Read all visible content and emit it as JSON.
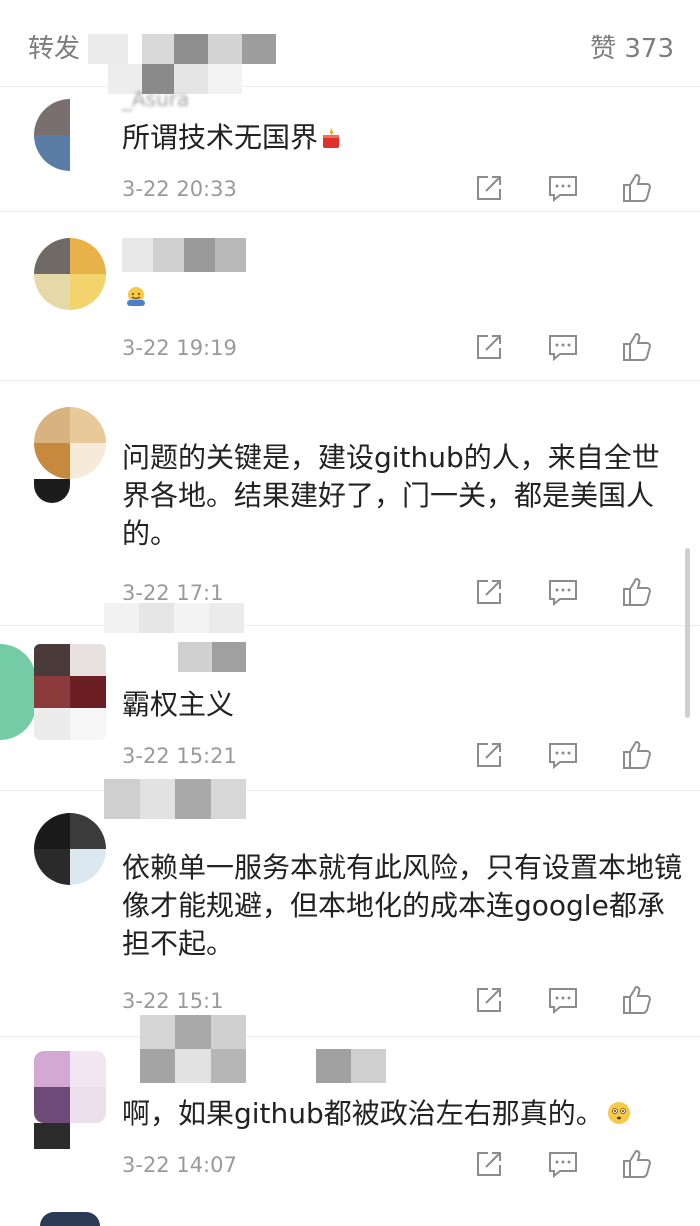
{
  "header": {
    "repost_label": "转发",
    "likes_label": "赞 373"
  },
  "comments": [
    {
      "username": "_Asura",
      "text": "所谓技术无国界",
      "time": "3-22 20:33",
      "emoji": "firecracker-emoji"
    },
    {
      "username": "",
      "text": "",
      "time": "3-22 19:19",
      "emoji": "hug-emoji"
    },
    {
      "username": "",
      "text": "问题的关键是，建设github的人，来自全世界各地。结果建好了，门一关，都是美国人的。",
      "time": "3-22 17:1"
    },
    {
      "username": "",
      "text": "霸权主义",
      "time": "3-22 15:21"
    },
    {
      "username": "",
      "text": "依赖单一服务本就有此风险，只有设置本地镜像才能规避，但本地化的成本连google都承担不起。",
      "time": "3-22 15:1"
    },
    {
      "username": "",
      "text": "啊，如果github都被政治左右那真的。",
      "time": "3-22 14:07",
      "emoji": "flushed-face-emoji"
    }
  ],
  "actions": {
    "icons": [
      "repost-icon",
      "comment-icon",
      "like-icon"
    ]
  },
  "colors": {
    "text": "#222222",
    "meta": "#9a9a9a",
    "icon": "#8c8c8c",
    "divider": "#ececec"
  }
}
